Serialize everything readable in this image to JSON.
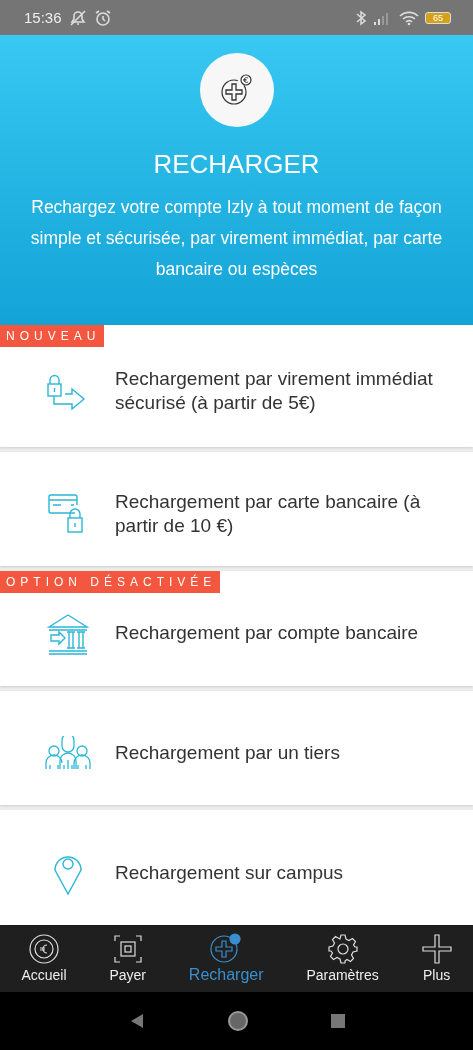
{
  "status_bar": {
    "time": "15:36",
    "battery": "65"
  },
  "header": {
    "title": "RECHARGER",
    "description": "Rechargez votre compte Izly à tout moment de façon simple et sécurisée, par virement immédiat, par carte bancaire ou espèces"
  },
  "options": [
    {
      "kind": "transfer",
      "badge": "NOUVEAU",
      "label": "Rechargement par virement immédiat sécurisé (à partir de 5€)"
    },
    {
      "kind": "card",
      "label": "Rechargement par carte bancaire (à partir de 10 €)"
    },
    {
      "kind": "bank",
      "badge": "OPTION DÉSACTIVÉE",
      "label": "Rechargement par compte bancaire"
    },
    {
      "kind": "people",
      "label": "Rechargement par un tiers"
    },
    {
      "kind": "location",
      "label": "Rechargement sur campus"
    }
  ],
  "bottom_nav": [
    {
      "kind": "home",
      "label": "Accueil",
      "selected": false
    },
    {
      "kind": "pay",
      "label": "Payer",
      "selected": false
    },
    {
      "kind": "topup",
      "label": "Recharger",
      "selected": true
    },
    {
      "kind": "settings",
      "label": "Paramètres",
      "selected": false
    },
    {
      "kind": "more",
      "label": "Plus",
      "selected": false
    }
  ]
}
